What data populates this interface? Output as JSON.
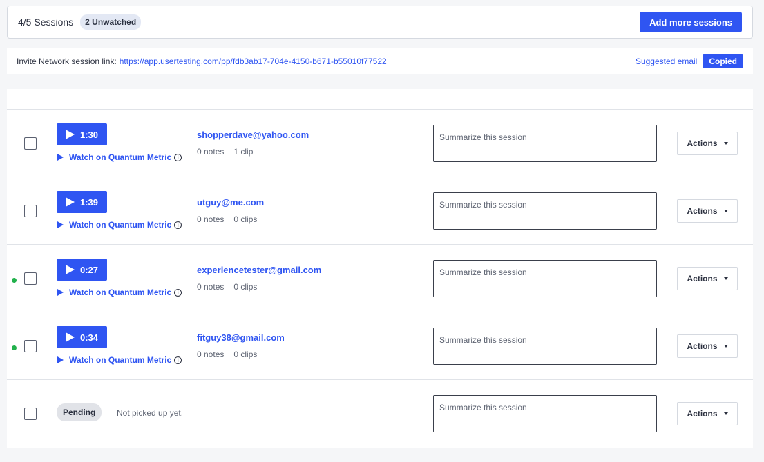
{
  "header": {
    "sessions_count": "4/5 Sessions",
    "unwatched_badge": "2 Unwatched",
    "add_button": "Add more sessions"
  },
  "invite": {
    "label": "Invite Network session link:",
    "link": "https://app.usertesting.com/pp/fdb3ab17-704e-4150-b671-b55010f77522",
    "suggested_email": "Suggested email",
    "copied": "Copied"
  },
  "common": {
    "watch_label": "Watch on Quantum Metric",
    "summary_placeholder": "Summarize this session",
    "actions_label": "Actions",
    "info_glyph": "i"
  },
  "sessions": [
    {
      "duration": "1:30",
      "email": "shopperdave@yahoo.com",
      "notes": "0 notes",
      "clips": "1 clip",
      "unwatched": false
    },
    {
      "duration": "1:39",
      "email": "utguy@me.com",
      "notes": "0 notes",
      "clips": "0 clips",
      "unwatched": false
    },
    {
      "duration": "0:27",
      "email": "experiencetester@gmail.com",
      "notes": "0 notes",
      "clips": "0 clips",
      "unwatched": true
    },
    {
      "duration": "0:34",
      "email": "fitguy38@gmail.com",
      "notes": "0 notes",
      "clips": "0 clips",
      "unwatched": true
    }
  ],
  "pending": {
    "badge": "Pending",
    "text": "Not picked up yet."
  },
  "colors": {
    "accent": "#2f55f2",
    "unwatched_dot": "#22b14c"
  },
  "icons": {
    "play": "play-icon",
    "info": "info-icon",
    "caret": "caret-down-icon"
  }
}
